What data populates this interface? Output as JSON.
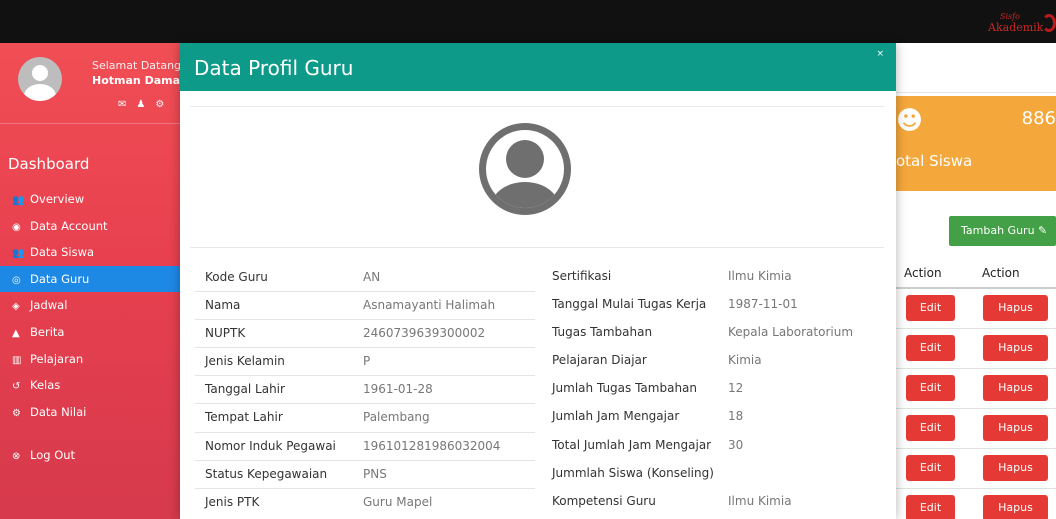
{
  "brand": {
    "line1": "Sisfo",
    "line2": "Akademik"
  },
  "sidebar": {
    "welcome": "Selamat Datang",
    "username": "Hotman Damanik",
    "user_icons": [
      "envelope-icon",
      "user-icon",
      "gear-icon"
    ],
    "section_title": "Dashboard",
    "items": [
      {
        "label": "Overview",
        "icon": "users-icon"
      },
      {
        "label": "Data Account",
        "icon": "eye-icon"
      },
      {
        "label": "Data Siswa",
        "icon": "users-icon"
      },
      {
        "label": "Data Guru",
        "icon": "circle-dot-icon",
        "active": true
      },
      {
        "label": "Jadwal",
        "icon": "diamond-icon"
      },
      {
        "label": "Berita",
        "icon": "bell-icon"
      },
      {
        "label": "Pelajaran",
        "icon": "bank-icon"
      },
      {
        "label": "Kelas",
        "icon": "refresh-icon"
      },
      {
        "label": "Data Nilai",
        "icon": "gear-icon"
      },
      {
        "label": "Log Out",
        "icon": "close-circle-icon"
      }
    ]
  },
  "background": {
    "stat_value": "886",
    "stat_label": "otal Siswa",
    "add_button": "Tambah Guru",
    "col_action1": "Action",
    "col_action2": "Action",
    "row_buttons": {
      "edit": "Edit",
      "hapus": "Hapus"
    }
  },
  "modal": {
    "title": "Data Profil Guru",
    "close": "×",
    "left_fields": [
      {
        "label": "Kode Guru",
        "value": "AN"
      },
      {
        "label": "Nama",
        "value": "Asnamayanti Halimah"
      },
      {
        "label": "NUPTK",
        "value": "2460739639300002"
      },
      {
        "label": "Jenis Kelamin",
        "value": "P"
      },
      {
        "label": "Tanggal Lahir",
        "value": "1961-01-28"
      },
      {
        "label": "Tempat Lahir",
        "value": "Palembang"
      },
      {
        "label": "Nomor Induk Pegawai",
        "value": "196101281986032004"
      },
      {
        "label": "Status Kepegawaian",
        "value": "PNS"
      },
      {
        "label": "Jenis PTK",
        "value": "Guru Mapel"
      }
    ],
    "right_fields": [
      {
        "label": "Sertifikasi",
        "value": "Ilmu Kimia"
      },
      {
        "label": "Tanggal Mulai Tugas Kerja",
        "value": "1987-11-01"
      },
      {
        "label": "Tugas Tambahan",
        "value": "Kepala Laboratorium"
      },
      {
        "label": "Pelajaran Diajar",
        "value": "Kimia"
      },
      {
        "label": "Jumlah Tugas Tambahan",
        "value": "12"
      },
      {
        "label": "Jumlah Jam Mengajar",
        "value": "18"
      },
      {
        "label": "Total Jumlah Jam Mengajar",
        "value": "30"
      },
      {
        "label": "Jummlah Siswa (Konseling)",
        "value": ""
      },
      {
        "label": "Kompetensi Guru",
        "value": "Ilmu Kimia"
      }
    ]
  },
  "colors": {
    "modal_header": "#0e9a88",
    "sidebar": "#e8404f",
    "active_menu": "#1e88e5",
    "danger": "#e53935",
    "success": "#43a047",
    "stat_card": "#f4a73a"
  }
}
